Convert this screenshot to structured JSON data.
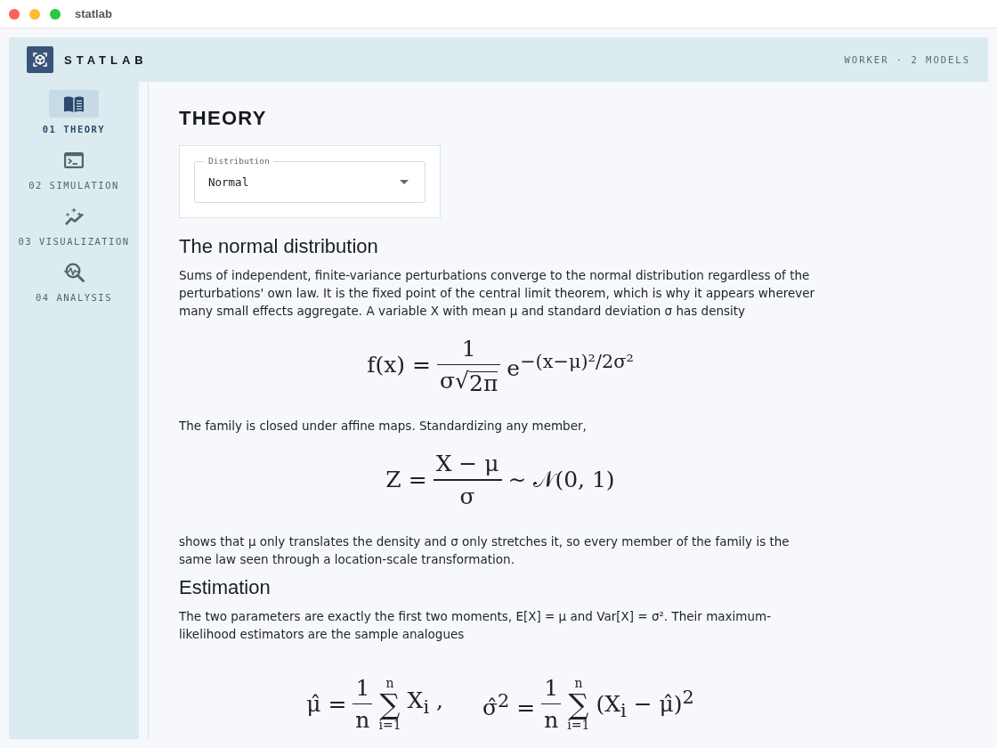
{
  "window": {
    "title": "statlab"
  },
  "app": {
    "name": "STATLAB",
    "status": "WORKER · 2 MODELS"
  },
  "nav": [
    {
      "label": "01 THEORY",
      "selected": true
    },
    {
      "label": "02 SIMULATION",
      "selected": false
    },
    {
      "label": "03 VISUALIZATION",
      "selected": false
    },
    {
      "label": "04 ANALYSIS",
      "selected": false
    }
  ],
  "page": {
    "title": "THEORY",
    "distribution_select": {
      "label": "Distribution",
      "value": "Normal"
    },
    "sections": [
      {
        "heading": "The normal distribution",
        "blocks": [
          {
            "kind": "paragraph",
            "text": "Sums of independent, finite-variance perturbations converge to the normal distribution regardless of the perturbations' own law. It is the fixed point of the central limit theorem, which is why it appears wherever many small effects aggregate. A variable X with mean μ and standard deviation σ has density"
          },
          {
            "kind": "formula",
            "groups": [
              [
                {
                  "kind": "text",
                  "text": "f(x) ="
                },
                {
                  "kind": "fraction",
                  "numerator": [
                    {
                      "kind": "text",
                      "text": "1"
                    }
                  ],
                  "denominator": [
                    {
                      "kind": "text",
                      "text": "σ"
                    },
                    {
                      "kind": "root",
                      "sign": "√",
                      "text": "2π"
                    }
                  ]
                },
                {
                  "kind": "text",
                  "text": "e$^{−(x−μ)²/2σ²}$"
                }
              ]
            ]
          },
          {
            "kind": "paragraph",
            "text": "The family is closed under affine maps. Standardizing any member,"
          },
          {
            "kind": "formula",
            "groups": [
              [
                {
                  "kind": "text",
                  "text": "Z ="
                },
                {
                  "kind": "fraction",
                  "numerator": [
                    {
                      "kind": "text",
                      "text": "X − μ"
                    }
                  ],
                  "denominator": [
                    {
                      "kind": "text",
                      "text": "σ"
                    }
                  ]
                },
                {
                  "kind": "text",
                  "text": "∼ 𝒩(0, 1)"
                }
              ]
            ]
          },
          {
            "kind": "paragraph",
            "text": "shows that μ only translates the density and σ only stretches it, so every member of the family is the same law seen through a location-scale transformation."
          }
        ]
      },
      {
        "heading": "Estimation",
        "blocks": [
          {
            "kind": "paragraph",
            "text": "The two parameters are exactly the first two moments, E[X] = μ and Var[X] = σ². Their maximum-likelihood estimators are the sample analogues"
          },
          {
            "kind": "formula",
            "groups": [
              [
                {
                  "kind": "text",
                  "text": "μ̂ ="
                },
                {
                  "kind": "fraction",
                  "numerator": [
                    {
                      "kind": "text",
                      "text": "1"
                    }
                  ],
                  "denominator": [
                    {
                      "kind": "text",
                      "text": "n"
                    }
                  ]
                },
                {
                  "kind": "sum",
                  "sign": "∑",
                  "upper": "n",
                  "lower": "i=1"
                },
                {
                  "kind": "text",
                  "text": "X$_{i}$ ,"
                }
              ],
              [
                {
                  "kind": "text",
                  "text": "σ̂$^{2}$ ="
                },
                {
                  "kind": "fraction",
                  "numerator": [
                    {
                      "kind": "text",
                      "text": "1"
                    }
                  ],
                  "denominator": [
                    {
                      "kind": "text",
                      "text": "n"
                    }
                  ]
                },
                {
                  "kind": "sum",
                  "sign": "∑",
                  "upper": "n",
                  "lower": "i=1"
                },
                {
                  "kind": "text",
                  "text": "(X$_{i}$ − μ̂)$^{2}$"
                }
              ]
            ]
          }
        ]
      }
    ]
  }
}
